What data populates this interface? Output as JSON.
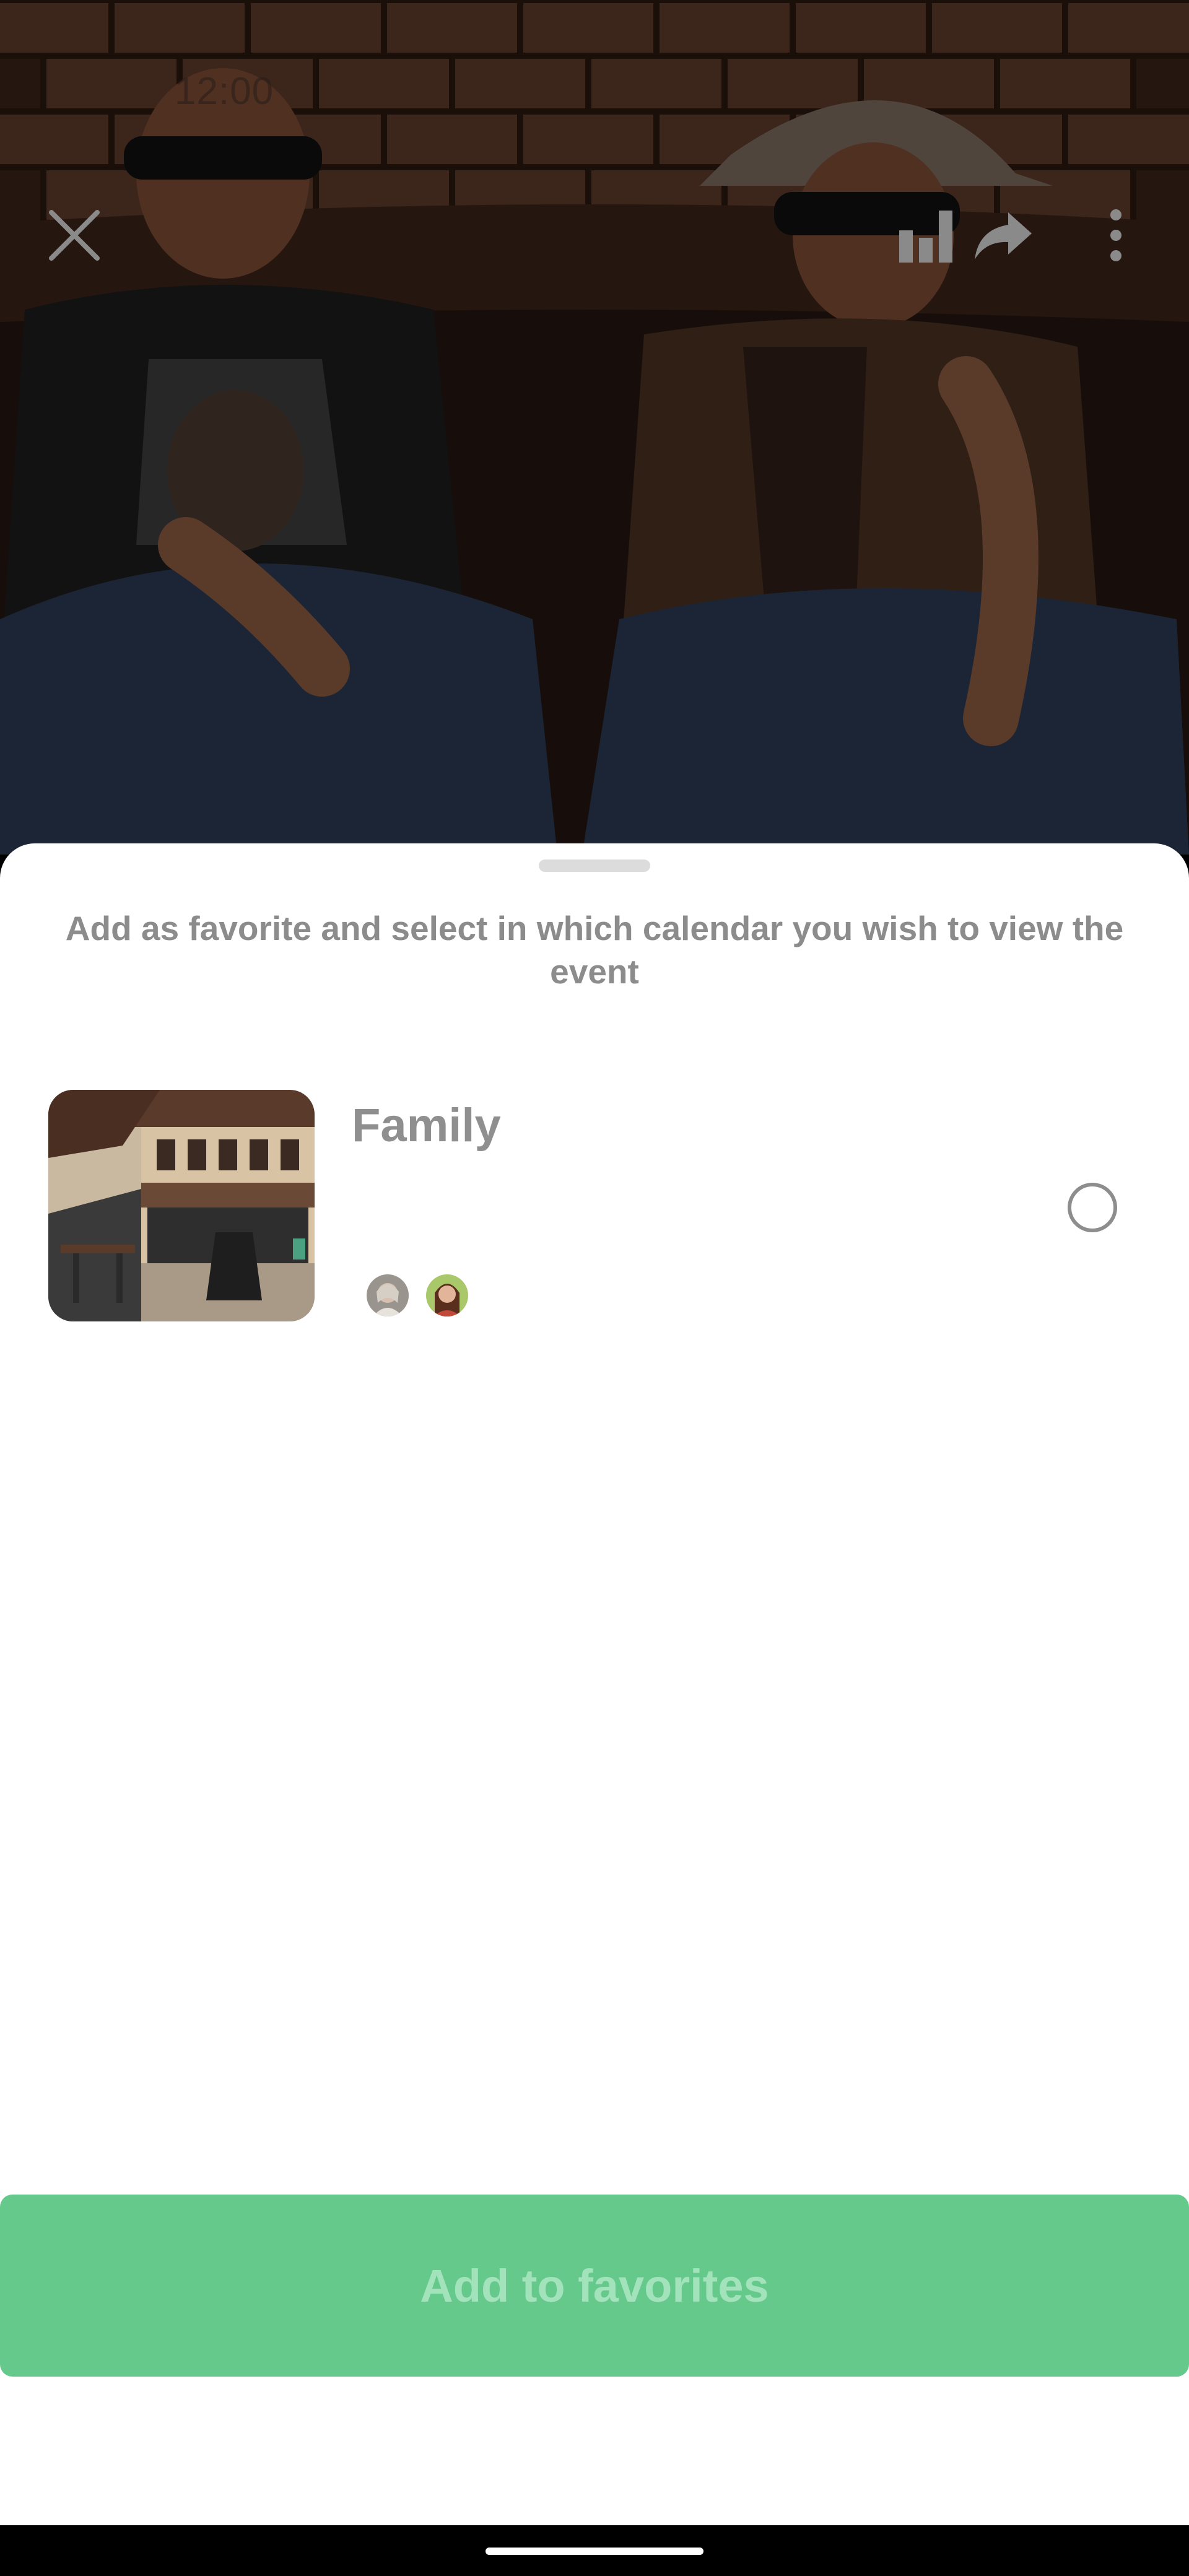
{
  "status_bar": {
    "time": "12:00"
  },
  "event_header": {
    "close_icon": "close-icon",
    "stats_icon": "bar-chart-icon",
    "share_icon": "share-arrow-icon",
    "more_icon": "more-vertical-icon"
  },
  "sheet": {
    "title": "Add as favorite and select in which calendar you wish to view the event",
    "calendars": [
      {
        "name": "Family",
        "selected": false,
        "member_count": 2
      }
    ],
    "action_label": "Add to favorites"
  },
  "colors": {
    "accent": "#66c98c",
    "accent_text": "#a3e3bc",
    "muted_text": "#8c8c8c"
  }
}
